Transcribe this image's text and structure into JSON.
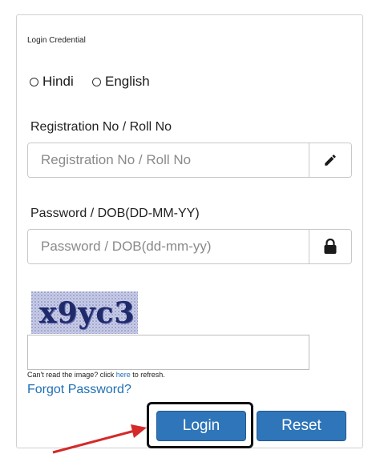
{
  "form": {
    "legend": "Login Credential",
    "language_options": [
      "Hindi",
      "English"
    ],
    "registration": {
      "label": "Registration No / Roll No",
      "placeholder": "Registration No / Roll No",
      "icon": "pencil-icon"
    },
    "password": {
      "label": "Password / DOB(DD-MM-YY)",
      "placeholder": "Password / DOB(dd-mm-yy)",
      "icon": "lock-icon"
    },
    "captcha": {
      "text": "x9yc3",
      "hint_prefix": "Can't read the image? click ",
      "hint_link": "here",
      "hint_suffix": " to refresh."
    },
    "forgot_password": "Forgot Password?",
    "buttons": {
      "login": "Login",
      "reset": "Reset"
    }
  },
  "annotation": {
    "color": "#d42a2a"
  },
  "colors": {
    "button_bg": "#2f75b9",
    "link": "#1f6fb5"
  }
}
